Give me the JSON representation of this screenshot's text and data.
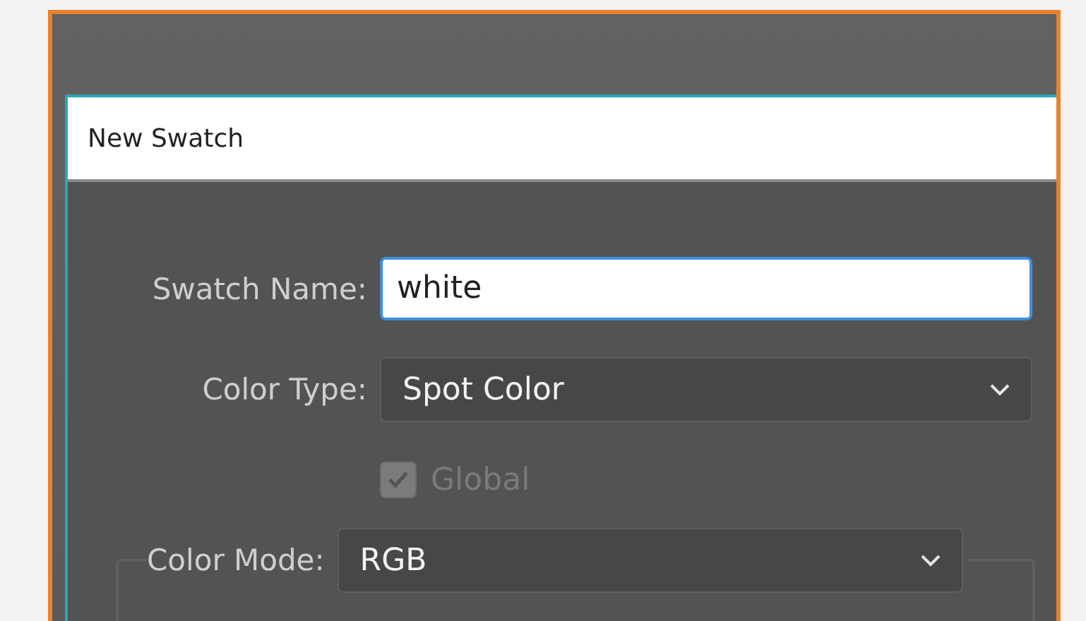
{
  "dialog": {
    "title": "New Swatch",
    "fields": [
      {
        "kind": "text",
        "label": "Swatch Name:",
        "value": "white",
        "focused": true
      },
      {
        "kind": "select",
        "label": "Color Type:",
        "value": "Spot Color"
      },
      {
        "kind": "checkbox",
        "label": "Global",
        "checked": true,
        "disabled": true
      }
    ],
    "color_mode": {
      "label": "Color Mode:",
      "value": "RGB"
    }
  }
}
